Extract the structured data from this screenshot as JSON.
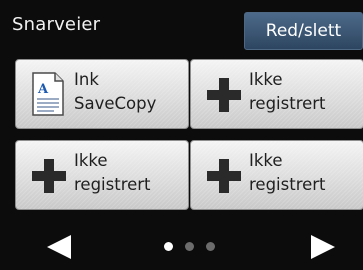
{
  "header": {
    "title": "Snarveier",
    "edit_label": "Red/slett"
  },
  "shortcuts": [
    {
      "label": "Ink\nSaveCopy",
      "icon": "document-icon"
    },
    {
      "label": "Ikke\nregistrert",
      "icon": "plus-icon"
    },
    {
      "label": "Ikke\nregistrert",
      "icon": "plus-icon"
    },
    {
      "label": "Ikke\nregistrert",
      "icon": "plus-icon"
    }
  ],
  "pager": {
    "current_page": 1,
    "page_count": 3
  },
  "colors": {
    "background": "#0c0c0c",
    "accent_button": "#3b5573",
    "tile_light": "#f4f4f4",
    "tile_dark": "#c9c9c9"
  }
}
